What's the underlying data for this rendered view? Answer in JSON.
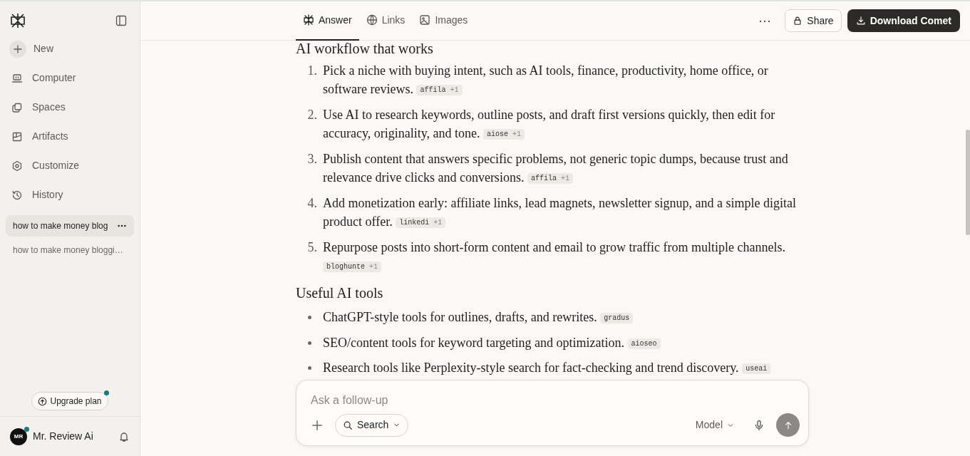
{
  "sidebar": {
    "nav": [
      {
        "label": "New",
        "kind": "new"
      },
      {
        "label": "Computer",
        "kind": "computer"
      },
      {
        "label": "Spaces",
        "kind": "spaces"
      },
      {
        "label": "Artifacts",
        "kind": "artifacts"
      },
      {
        "label": "Customize",
        "kind": "customize"
      },
      {
        "label": "History",
        "kind": "history"
      }
    ],
    "threads": [
      {
        "title": "how to make money blog",
        "selected": true
      },
      {
        "title": "how to make money bloggi…",
        "selected": false
      }
    ],
    "upgrade": {
      "label": "Upgrade plan",
      "notify": true
    },
    "user": {
      "initials": "MR",
      "name": "Mr. Review Ai",
      "online": true
    }
  },
  "header": {
    "tabs": [
      {
        "label": "Answer",
        "kind": "answer",
        "selected": true
      },
      {
        "label": "Links",
        "kind": "links",
        "selected": false
      },
      {
        "label": "Images",
        "kind": "images",
        "selected": false
      }
    ],
    "more": "⋯",
    "share": "Share",
    "download": "Download Comet"
  },
  "answer": {
    "sections": [
      {
        "heading": "AI workflow that works",
        "kind": "ordered",
        "items": [
          {
            "number": "1.",
            "text": "Pick a niche with buying intent, such as AI tools, finance, productivity, home office, or software reviews.",
            "source": "affila",
            "more": "+1"
          },
          {
            "number": "2.",
            "text": "Use AI to research keywords, outline posts, and draft first versions quickly, then edit for accuracy, originality, and tone.",
            "source": "aiose",
            "more": "+1"
          },
          {
            "number": "3.",
            "text": "Publish content that answers specific problems, not generic topic dumps, because trust and relevance drive clicks and conversions.",
            "source": "affila",
            "more": "+1"
          },
          {
            "number": "4.",
            "text": "Add monetization early: affiliate links, lead magnets, newsletter signup, and a simple digital product offer.",
            "source": "linkedi",
            "more": "+1"
          },
          {
            "number": "5.",
            "text": "Repurpose posts into short-form content and email to grow traffic from multiple channels.",
            "source": "bloghunte",
            "more": "+1"
          }
        ]
      },
      {
        "heading": "Useful AI tools",
        "kind": "bullet",
        "items": [
          {
            "text": "ChatGPT-style tools for outlines, drafts, and rewrites.",
            "source": "gradus"
          },
          {
            "text": "SEO/content tools for keyword targeting and optimization.",
            "source": "aioseo"
          },
          {
            "text": "Research tools like Perplexity-style search for fact-checking and trend discovery.",
            "source": "useai"
          }
        ]
      }
    ]
  },
  "composer": {
    "placeholder": "Ask a follow-up",
    "search": "Search",
    "model": "Model"
  }
}
